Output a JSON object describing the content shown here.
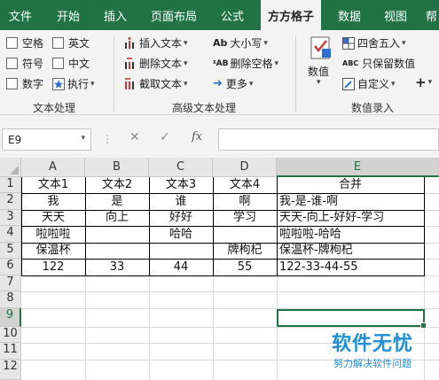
{
  "ribbon_tabs": [
    "文件",
    "开始",
    "插入",
    "页面布局",
    "公式",
    "方方格子",
    "数据",
    "视图",
    "帮"
  ],
  "active_tab": "方方格子",
  "text_processing": {
    "checkboxes": [
      "空格",
      "英文",
      "符号",
      "中文",
      "数字"
    ],
    "execute_label": "执行",
    "group_label": "文本处理"
  },
  "advanced_text": {
    "insert_text": "插入文本",
    "delete_text": "删除文本",
    "extract_text": "截取文本",
    "case": "大小写",
    "delete_spaces": "删除空格",
    "more": "更多",
    "group_label": "高级文本处理"
  },
  "numeric_entry": {
    "numeric": "数值",
    "round": "四舍五入",
    "keep_values": "只保留数值",
    "custom": "自定义",
    "group_label": "数值录入"
  },
  "formula_bar": {
    "name_box": "E9",
    "fx": "fx",
    "formula": ""
  },
  "columns": [
    "A",
    "B",
    "C",
    "D",
    "E"
  ],
  "rows": [
    "1",
    "2",
    "3",
    "4",
    "5",
    "6",
    "7",
    "8",
    "9",
    "10",
    "11",
    "12"
  ],
  "cells": {
    "r1": [
      "文本1",
      "文本2",
      "文本3",
      "文本4",
      "合并"
    ],
    "r2": [
      "我",
      "是",
      "谁",
      "啊",
      "我-是-谁-啊"
    ],
    "r3": [
      "天天",
      "向上",
      "好好",
      "学习",
      "天天-向上-好好-学习"
    ],
    "r4": [
      "啦啦啦",
      "",
      "哈哈",
      "",
      "啦啦啦-哈哈"
    ],
    "r5": [
      "保温杯",
      "",
      "",
      "牌枸杞",
      "保温杯-牌枸杞"
    ],
    "r6": [
      "122",
      "33",
      "44",
      "55",
      "122-33-44-55"
    ]
  },
  "selected_cell": "E9",
  "watermark": {
    "title": "软件无忧",
    "subtitle": "努力解决软件问题"
  },
  "colors": {
    "ribbon_green": "#217346",
    "watermark_blue": "#1e8fd6"
  }
}
